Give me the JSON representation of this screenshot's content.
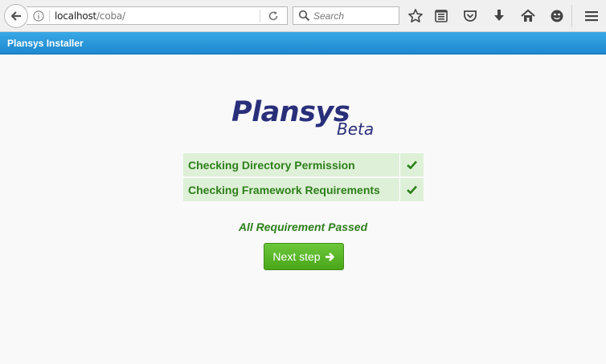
{
  "browser": {
    "url_host": "localhost",
    "url_path": "/coba/",
    "search_placeholder": "Search",
    "icons": [
      "back-icon",
      "info-icon",
      "reload-icon",
      "search-icon",
      "bookmark-star-icon",
      "reader-list-icon",
      "pocket-icon",
      "download-icon",
      "home-icon",
      "emoji-icon",
      "hamburger-menu-icon"
    ]
  },
  "app": {
    "header_title": "Plansys Installer",
    "logo_text": "Plansys",
    "logo_badge": "Beta",
    "checks": [
      {
        "label": "Checking Directory Permission",
        "status": "check-icon"
      },
      {
        "label": "Checking Framework Requirements",
        "status": "check-icon"
      }
    ],
    "result_text": "All Requirement Passed",
    "next_button_label": "Next step"
  },
  "colors": {
    "header_blue": "#1e88cf",
    "success_green": "#2d7f1a",
    "success_bg": "#dff0d8",
    "button_green": "#5bb72a",
    "logo_navy": "#2a2f7a"
  }
}
